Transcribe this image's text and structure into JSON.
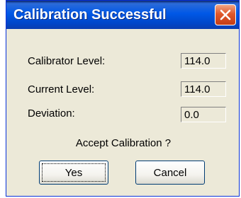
{
  "window": {
    "title": "Calibration Successful",
    "close_icon": "close-icon"
  },
  "fields": [
    {
      "label": "Calibrator Level:",
      "value": "114.0"
    },
    {
      "label": "Current Level:",
      "value": "114.0"
    },
    {
      "label": "Deviation:",
      "value": "0.0"
    }
  ],
  "prompt": {
    "question": "Accept Calibration ?"
  },
  "buttons": {
    "yes_label": "Yes",
    "cancel_label": "Cancel"
  },
  "colors": {
    "titlebar": "#0058e6",
    "close_button": "#e0582c",
    "dialog_background": "#ece9d8"
  }
}
